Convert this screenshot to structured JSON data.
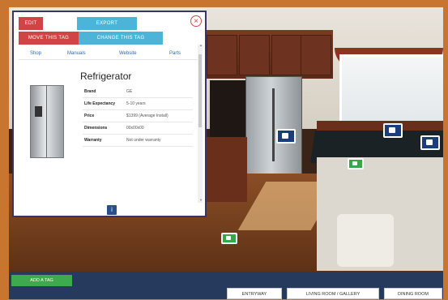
{
  "popup": {
    "buttons": {
      "edit": "EDIT",
      "export": "EXPORT",
      "move_tag": "MOVE THIS TAG",
      "change_tag": "CHANGE THIS TAG"
    },
    "close_symbol": "×",
    "tabs": [
      "Shop",
      "Manuals",
      "Website",
      "Parts"
    ],
    "product": {
      "title": "Refrigerator",
      "specs": [
        {
          "key": "Brand",
          "value": "GE"
        },
        {
          "key": "Life Expectancy",
          "value": "5-10 years"
        },
        {
          "key": "Price",
          "value": "$1399 (Average Install)"
        },
        {
          "key": "Dimensions",
          "value": "00x00x00"
        },
        {
          "key": "Warranty",
          "value": "Not under warranty"
        }
      ]
    },
    "info_label": "i"
  },
  "footer": {
    "add_tag": "ADD A TAG",
    "rooms": [
      "ENTRYWAY",
      "LIVING ROOM / GALLERY",
      "DINING ROOM"
    ]
  },
  "colors": {
    "border": "#c8762f",
    "bar": "#263a5e",
    "accent_red": "#cf4545",
    "accent_cyan": "#4cb4d9",
    "accent_green": "#3daa4d",
    "hotspot": "#1b3d7a"
  },
  "icons": {
    "close": "close-icon",
    "hotspot": "tag-hotspot-icon",
    "info": "info-icon"
  }
}
